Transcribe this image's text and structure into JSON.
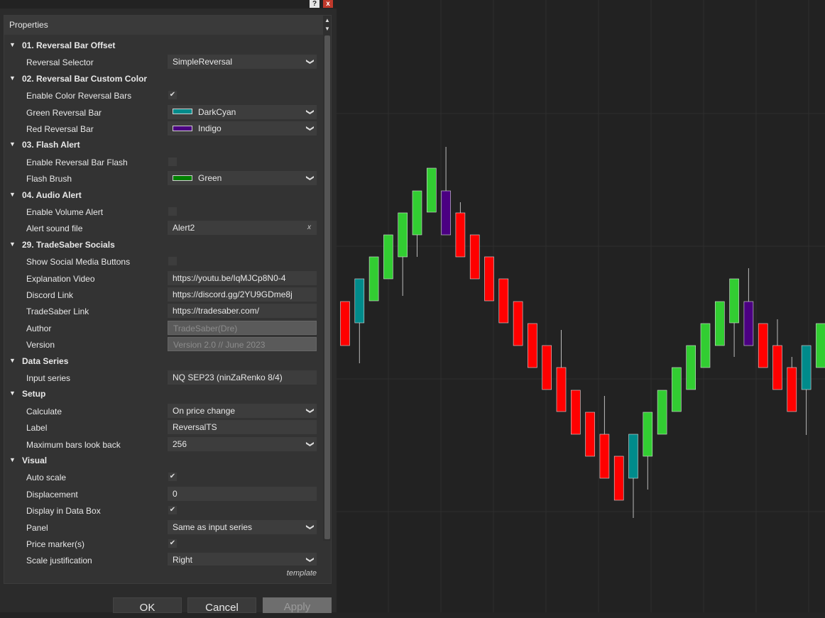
{
  "window": {
    "help_icon": "?",
    "close_icon": "x"
  },
  "properties_header": "Properties",
  "sections": [
    {
      "category": "01. Reversal Bar Offset",
      "rows": [
        {
          "name": "Reversal Selector",
          "type": "dropdown",
          "value": "SimpleReversal"
        }
      ]
    },
    {
      "category": "02. Reversal Bar Custom Color",
      "rows": [
        {
          "name": "Enable Color Reversal Bars",
          "type": "check",
          "checked": true
        },
        {
          "name": "Green Reversal Bar",
          "type": "color",
          "value": "DarkCyan",
          "color": "#008b8b"
        },
        {
          "name": "Red Reversal Bar",
          "type": "color",
          "value": "Indigo",
          "color": "#4b0082"
        }
      ]
    },
    {
      "category": "03. Flash Alert",
      "rows": [
        {
          "name": "Enable Reversal Bar Flash",
          "type": "check",
          "checked": false
        },
        {
          "name": "Flash Brush",
          "type": "color",
          "value": "Green",
          "color": "#008000"
        }
      ]
    },
    {
      "category": "04. Audio Alert",
      "rows": [
        {
          "name": "Enable Volume Alert",
          "type": "check",
          "checked": false
        },
        {
          "name": "Alert sound file",
          "type": "file",
          "value": "Alert2",
          "clear": "x"
        }
      ]
    },
    {
      "category": "29. TradeSaber Socials",
      "rows": [
        {
          "name": "Show Social Media Buttons",
          "type": "check",
          "checked": false
        },
        {
          "name": "Explanation Video",
          "type": "text",
          "value": "https://youtu.be/IqMJCp8N0-4"
        },
        {
          "name": "Discord Link",
          "type": "text",
          "value": "https://discord.gg/2YU9GDme8j"
        },
        {
          "name": "TradeSaber Link",
          "type": "text",
          "value": "https://tradesaber.com/"
        },
        {
          "name": "Author",
          "type": "readonly",
          "value": "TradeSaber(Dre)"
        },
        {
          "name": "Version",
          "type": "readonly",
          "value": "Version 2.0 // June 2023"
        }
      ]
    },
    {
      "category": "Data Series",
      "rows": [
        {
          "name": "Input series",
          "type": "text",
          "value": "NQ SEP23 (ninZaRenko 8/4)"
        }
      ]
    },
    {
      "category": "Setup",
      "rows": [
        {
          "name": "Calculate",
          "type": "dropdown",
          "value": "On price change"
        },
        {
          "name": "Label",
          "type": "text",
          "value": "ReversalTS"
        },
        {
          "name": "Maximum bars look back",
          "type": "dropdown",
          "value": "256"
        }
      ]
    },
    {
      "category": "Visual",
      "rows": [
        {
          "name": "Auto scale",
          "type": "check",
          "checked": true
        },
        {
          "name": "Displacement",
          "type": "text",
          "value": "0"
        },
        {
          "name": "Display in Data Box",
          "type": "check",
          "checked": true
        },
        {
          "name": "Panel",
          "type": "dropdown",
          "value": "Same as input series"
        },
        {
          "name": "Price marker(s)",
          "type": "check",
          "checked": true
        },
        {
          "name": "Scale justification",
          "type": "dropdown",
          "value": "Right"
        }
      ]
    }
  ],
  "template_link": "template",
  "buttons": {
    "ok": "OK",
    "cancel": "Cancel",
    "apply": "Apply"
  },
  "chart_colors": {
    "up": "#32cd32",
    "down": "#ff0000",
    "up_reversal": "#008b8b",
    "down_reversal": "#4b0082"
  }
}
